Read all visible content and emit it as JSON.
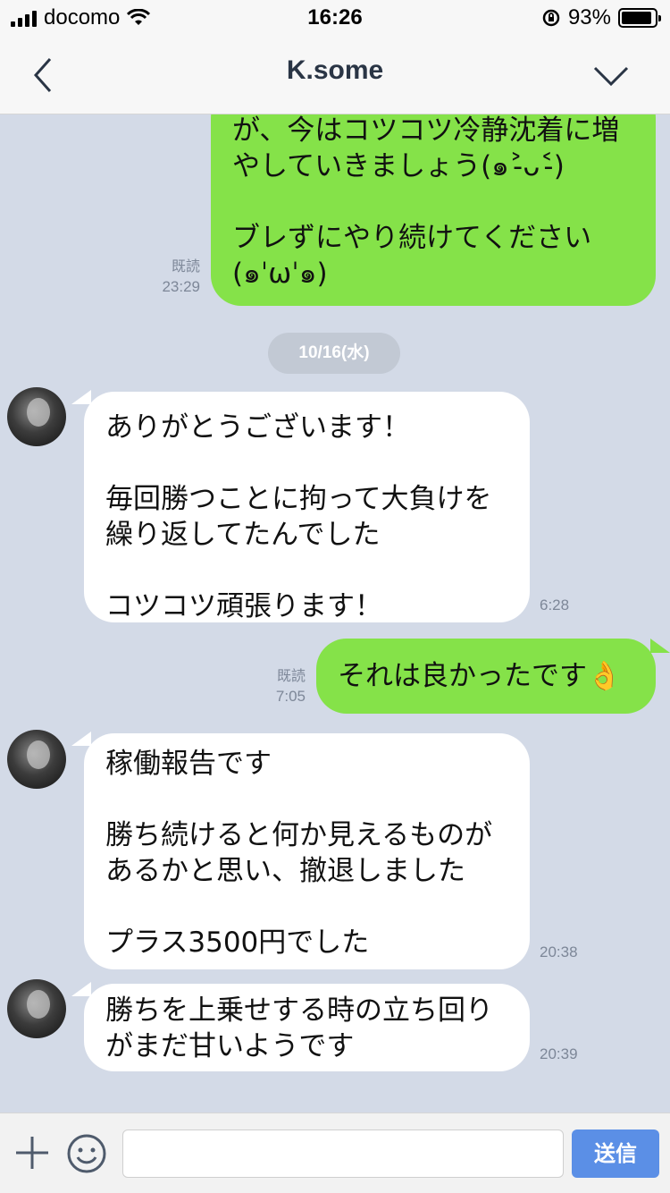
{
  "status_bar": {
    "carrier": "docomo",
    "time": "16:26",
    "battery": "93%",
    "battery_level": 0.93
  },
  "header": {
    "title": "K.some",
    "back_icon": "chevron-left-icon",
    "menu_icon": "chevron-down-icon"
  },
  "messages": [
    {
      "sender": "me",
      "text": "が、今はコツコツ冷静沈着に増\nやしていきましょう(๑˃̵ᴗ˂̵)\n\nブレずにやり続けてください\n(๑ˈωˈ๑)",
      "read": "既読",
      "time": "23:29"
    },
    {
      "type": "date",
      "label": "10/16(水)"
    },
    {
      "sender": "K.some",
      "text": "ありがとうございます！\n\n毎回勝つことに拘って大負けを\n繰り返してたんでした\n\nコツコツ頑張ります！",
      "time": "6:28"
    },
    {
      "sender": "me",
      "text": "それは良かったです👌",
      "read": "既読",
      "time": "7:05"
    },
    {
      "sender": "K.some",
      "text": "稼働報告です\n\n勝ち続けると何か見えるものが\nあるかと思い、撤退しました\n\nプラス3500円でした",
      "time": "20:38"
    },
    {
      "sender": "K.some",
      "text": "勝ちを上乗せする時の立ち回り\nがまだ甘いようです",
      "time": "20:39"
    }
  ],
  "composer": {
    "input_value": "",
    "send_label": "送信",
    "add_icon": "plus-icon",
    "emoji_icon": "smile-icon"
  },
  "colors": {
    "my_bubble": "#85e249",
    "their_bubble": "#ffffff",
    "chat_background": "#d3dae7",
    "send_button": "#5b8fe6"
  }
}
